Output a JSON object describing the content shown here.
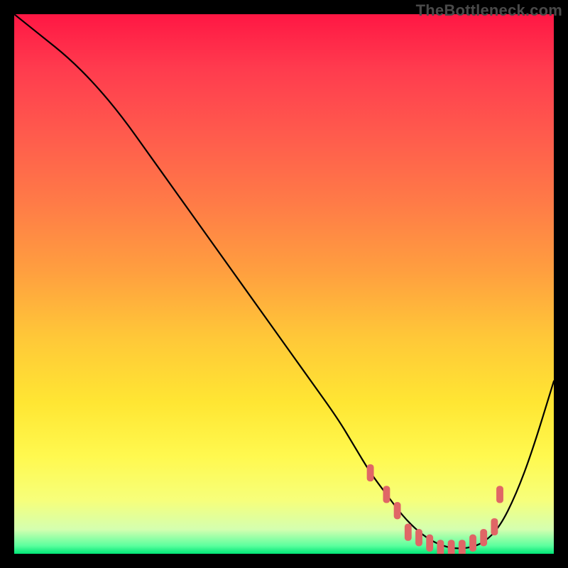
{
  "watermark": "TheBottleneck.com",
  "chart_data": {
    "type": "line",
    "title": "",
    "xlabel": "",
    "ylabel": "",
    "xlim": [
      0,
      100
    ],
    "ylim": [
      0,
      100
    ],
    "grid": false,
    "legend": false,
    "series": [
      {
        "name": "bottleneck-curve",
        "x": [
          0,
          5,
          10,
          15,
          20,
          25,
          30,
          35,
          40,
          45,
          50,
          55,
          60,
          63,
          66,
          69,
          72,
          75,
          78,
          81,
          84,
          87,
          90,
          93,
          96,
          100
        ],
        "values": [
          100,
          96,
          92,
          87,
          81,
          74,
          67,
          60,
          53,
          46,
          39,
          32,
          25,
          20,
          15,
          11,
          7,
          4,
          2,
          1,
          1,
          2,
          5,
          11,
          19,
          32
        ],
        "color": "#000000",
        "line_width": 2.2
      },
      {
        "name": "optimal-markers",
        "type": "scatter",
        "x": [
          66,
          69,
          71,
          73,
          75,
          77,
          79,
          81,
          83,
          85,
          87,
          89,
          90
        ],
        "values": [
          15,
          11,
          8,
          4,
          3,
          2,
          1,
          1,
          1,
          2,
          3,
          5,
          11
        ],
        "color": "#e06666",
        "marker": "rounded-rect",
        "marker_w": 1.3,
        "marker_h": 3.2
      }
    ],
    "gradient": {
      "name": "vertical-heat",
      "stops": [
        {
          "offset": 0.0,
          "color": "#ff1744"
        },
        {
          "offset": 0.1,
          "color": "#ff3b4e"
        },
        {
          "offset": 0.22,
          "color": "#ff5a4d"
        },
        {
          "offset": 0.35,
          "color": "#ff7b47"
        },
        {
          "offset": 0.48,
          "color": "#ffa03f"
        },
        {
          "offset": 0.6,
          "color": "#ffc838"
        },
        {
          "offset": 0.72,
          "color": "#ffe633"
        },
        {
          "offset": 0.82,
          "color": "#fff94f"
        },
        {
          "offset": 0.9,
          "color": "#f7ff7a"
        },
        {
          "offset": 0.955,
          "color": "#d4ffb0"
        },
        {
          "offset": 0.985,
          "color": "#5cff9e"
        },
        {
          "offset": 1.0,
          "color": "#00e676"
        }
      ]
    }
  }
}
